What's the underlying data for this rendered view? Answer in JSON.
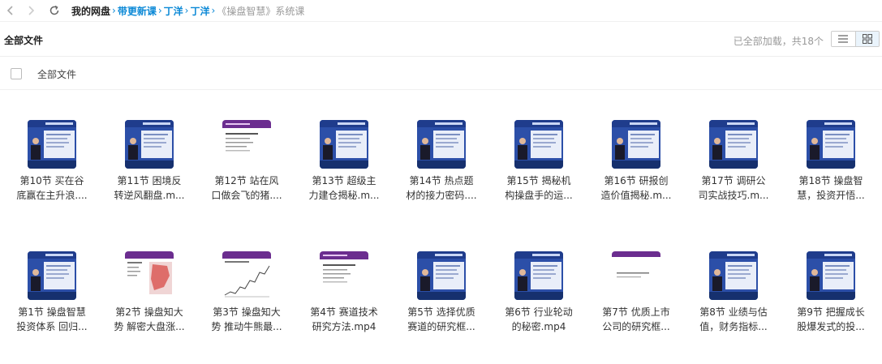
{
  "nav": {
    "back_icon": "chevron-left-icon",
    "forward_icon": "chevron-right-icon",
    "refresh_icon": "refresh-icon"
  },
  "breadcrumb": {
    "root": "我的网盘",
    "links": [
      "带更新课",
      "丁洋",
      "丁洋"
    ],
    "current": "《操盘智慧》系统课"
  },
  "header": {
    "title": "全部文件",
    "status": "已全部加载，共18个",
    "view_list_icon": "list-view-icon",
    "view_grid_icon": "grid-view-icon"
  },
  "select_all": {
    "label": "全部文件"
  },
  "files_row1": [
    {
      "line1": "第10节 买在谷",
      "line2": "底赢在主升浪....",
      "thumb": "video-presenter"
    },
    {
      "line1": "第11节 困境反",
      "line2": "转逆风翻盘.m...",
      "thumb": "video-presenter"
    },
    {
      "line1": "第12节 站在风",
      "line2": "口做会飞的猪....",
      "thumb": "slide-text"
    },
    {
      "line1": "第13节 超级主",
      "line2": "力建仓揭秘.m...",
      "thumb": "video-presenter"
    },
    {
      "line1": "第14节 热点题",
      "line2": "材的接力密码....",
      "thumb": "video-presenter"
    },
    {
      "line1": "第15节 揭秘机",
      "line2": "构操盘手的运...",
      "thumb": "video-presenter"
    },
    {
      "line1": "第16节 研报创",
      "line2": "造价值揭秘.m...",
      "thumb": "video-presenter"
    },
    {
      "line1": "第17节 调研公",
      "line2": "司实战技巧.m...",
      "thumb": "video-presenter"
    },
    {
      "line1": "第18节 操盘智",
      "line2": "慧，投资开悟...",
      "thumb": "video-presenter"
    }
  ],
  "files_row2": [
    {
      "line1": "第1节 操盘智慧",
      "line2": "投资体系 回归...",
      "thumb": "video-presenter"
    },
    {
      "line1": "第2节 操盘知大",
      "line2": "势 解密大盘涨...",
      "thumb": "slide-map"
    },
    {
      "line1": "第3节 操盘知大",
      "line2": "势 推动牛熊最...",
      "thumb": "slide-chart"
    },
    {
      "line1": "第4节 赛道技术",
      "line2": "研究方法.mp4",
      "thumb": "slide-text"
    },
    {
      "line1": "第5节 选择优质",
      "line2": "赛道的研究框...",
      "thumb": "video-presenter"
    },
    {
      "line1": "第6节 行业轮动",
      "line2": "的秘密.mp4",
      "thumb": "video-presenter"
    },
    {
      "line1": "第7节 优质上市",
      "line2": "公司的研究框...",
      "thumb": "slide-blank"
    },
    {
      "line1": "第8节 业绩与估",
      "line2": "值，财务指标...",
      "thumb": "video-presenter"
    },
    {
      "line1": "第9节 把握成长",
      "line2": "股爆发式的投...",
      "thumb": "video-presenter"
    }
  ],
  "colors": {
    "link": "#0a88d6",
    "video_bg": "#2c4fa8",
    "slide_header": "#6b2d8f"
  }
}
